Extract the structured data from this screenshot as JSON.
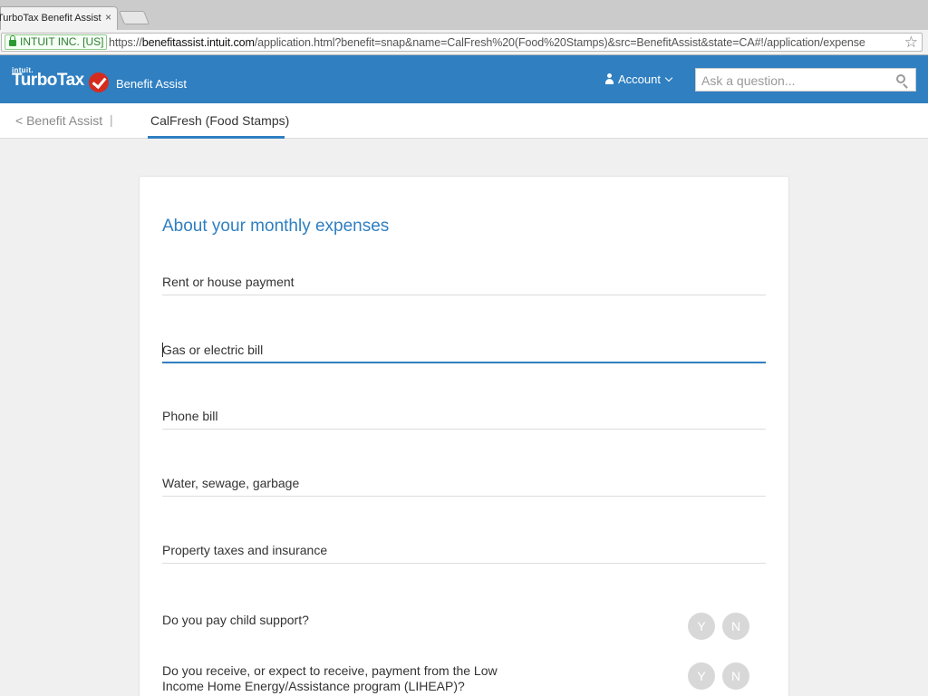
{
  "browser": {
    "tab_title": "TurboTax Benefit Assist",
    "tab_close": "×",
    "ev_label": "INTUIT INC. [US]",
    "url_scheme": "https://",
    "url_host": "benefitassist.intuit.com",
    "url_rest": "/application.html?benefit=snap&name=CalFresh%20(Food%20Stamps)&src=BenefitAssist&state=CA#!/application/expense",
    "star_glyph": "☆"
  },
  "header": {
    "brand_small": "intuit.",
    "brand_name": "TurboTax",
    "product_name": "Benefit Assist",
    "account_label": "Account",
    "search_placeholder": "Ask a question...",
    "brand_color": "#2f7fc1"
  },
  "subnav": {
    "back_label": "< Benefit Assist",
    "separator": "|",
    "active_tab": "CalFresh (Food Stamps)"
  },
  "form": {
    "title": "About your monthly expenses",
    "fields": [
      {
        "placeholder": "Rent or house payment",
        "value": ""
      },
      {
        "placeholder": "Gas or electric bill",
        "value": ""
      },
      {
        "placeholder": "Phone bill",
        "value": ""
      },
      {
        "placeholder": "Water, sewage, garbage",
        "value": ""
      },
      {
        "placeholder": "Property taxes and insurance",
        "value": ""
      }
    ],
    "questions": [
      {
        "text": "Do you pay child support?",
        "yes": "Y",
        "no": "N"
      },
      {
        "text": "Do you receive, or expect to receive, payment from the Low Income Home Energy/Assistance program (LIHEAP)?",
        "yes": "Y",
        "no": "N"
      }
    ]
  }
}
